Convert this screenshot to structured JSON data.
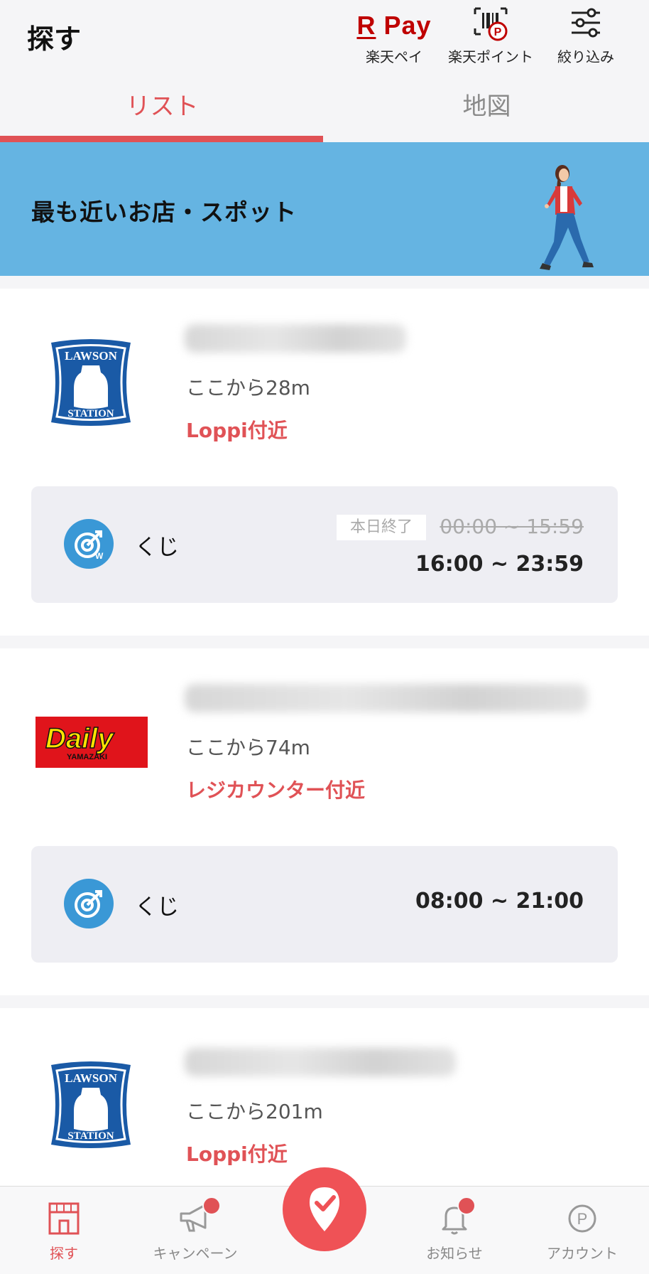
{
  "header": {
    "title": "探す",
    "rpay_logo": "Pay",
    "rpay_logo_r": "R",
    "rpay_label": "楽天ペイ",
    "points_label": "楽天ポイント",
    "filter_label": "絞り込み"
  },
  "tabs": [
    {
      "label": "リスト",
      "active": true
    },
    {
      "label": "地図",
      "active": false
    }
  ],
  "banner": {
    "text": "最も近いお店・スポット"
  },
  "stores": [
    {
      "brand": "LAWSON STATION",
      "distance": "ここから28m",
      "location": "Loppi付近",
      "kuji": {
        "label": "くじ",
        "ended_badge": "本日終了",
        "old_time": "00:00 ~ 15:59",
        "time": "16:00 ~ 23:59"
      }
    },
    {
      "brand": "Daily YAMAZAKI",
      "distance": "ここから74m",
      "location": "レジカウンター付近",
      "kuji": {
        "label": "くじ",
        "time": "08:00 ~ 21:00"
      }
    },
    {
      "brand": "LAWSON STATION",
      "distance": "ここから201m",
      "location": "Loppi付近"
    }
  ],
  "bottom_nav": [
    {
      "label": "探す",
      "icon": "store-icon",
      "active": true
    },
    {
      "label": "キャンペーン",
      "icon": "megaphone-icon",
      "badge": true
    },
    {
      "label": "",
      "icon": "location-check-icon"
    },
    {
      "label": "お知らせ",
      "icon": "bell-icon",
      "badge": true
    },
    {
      "label": "アカウント",
      "icon": "point-p-icon"
    }
  ],
  "colors": {
    "accent": "#e05256",
    "banner": "#65b4e2",
    "rakuten_red": "#bf0000",
    "lawson_blue": "#1a5aa6",
    "daily_red": "#e0141b",
    "daily_yellow": "#ffe400"
  }
}
